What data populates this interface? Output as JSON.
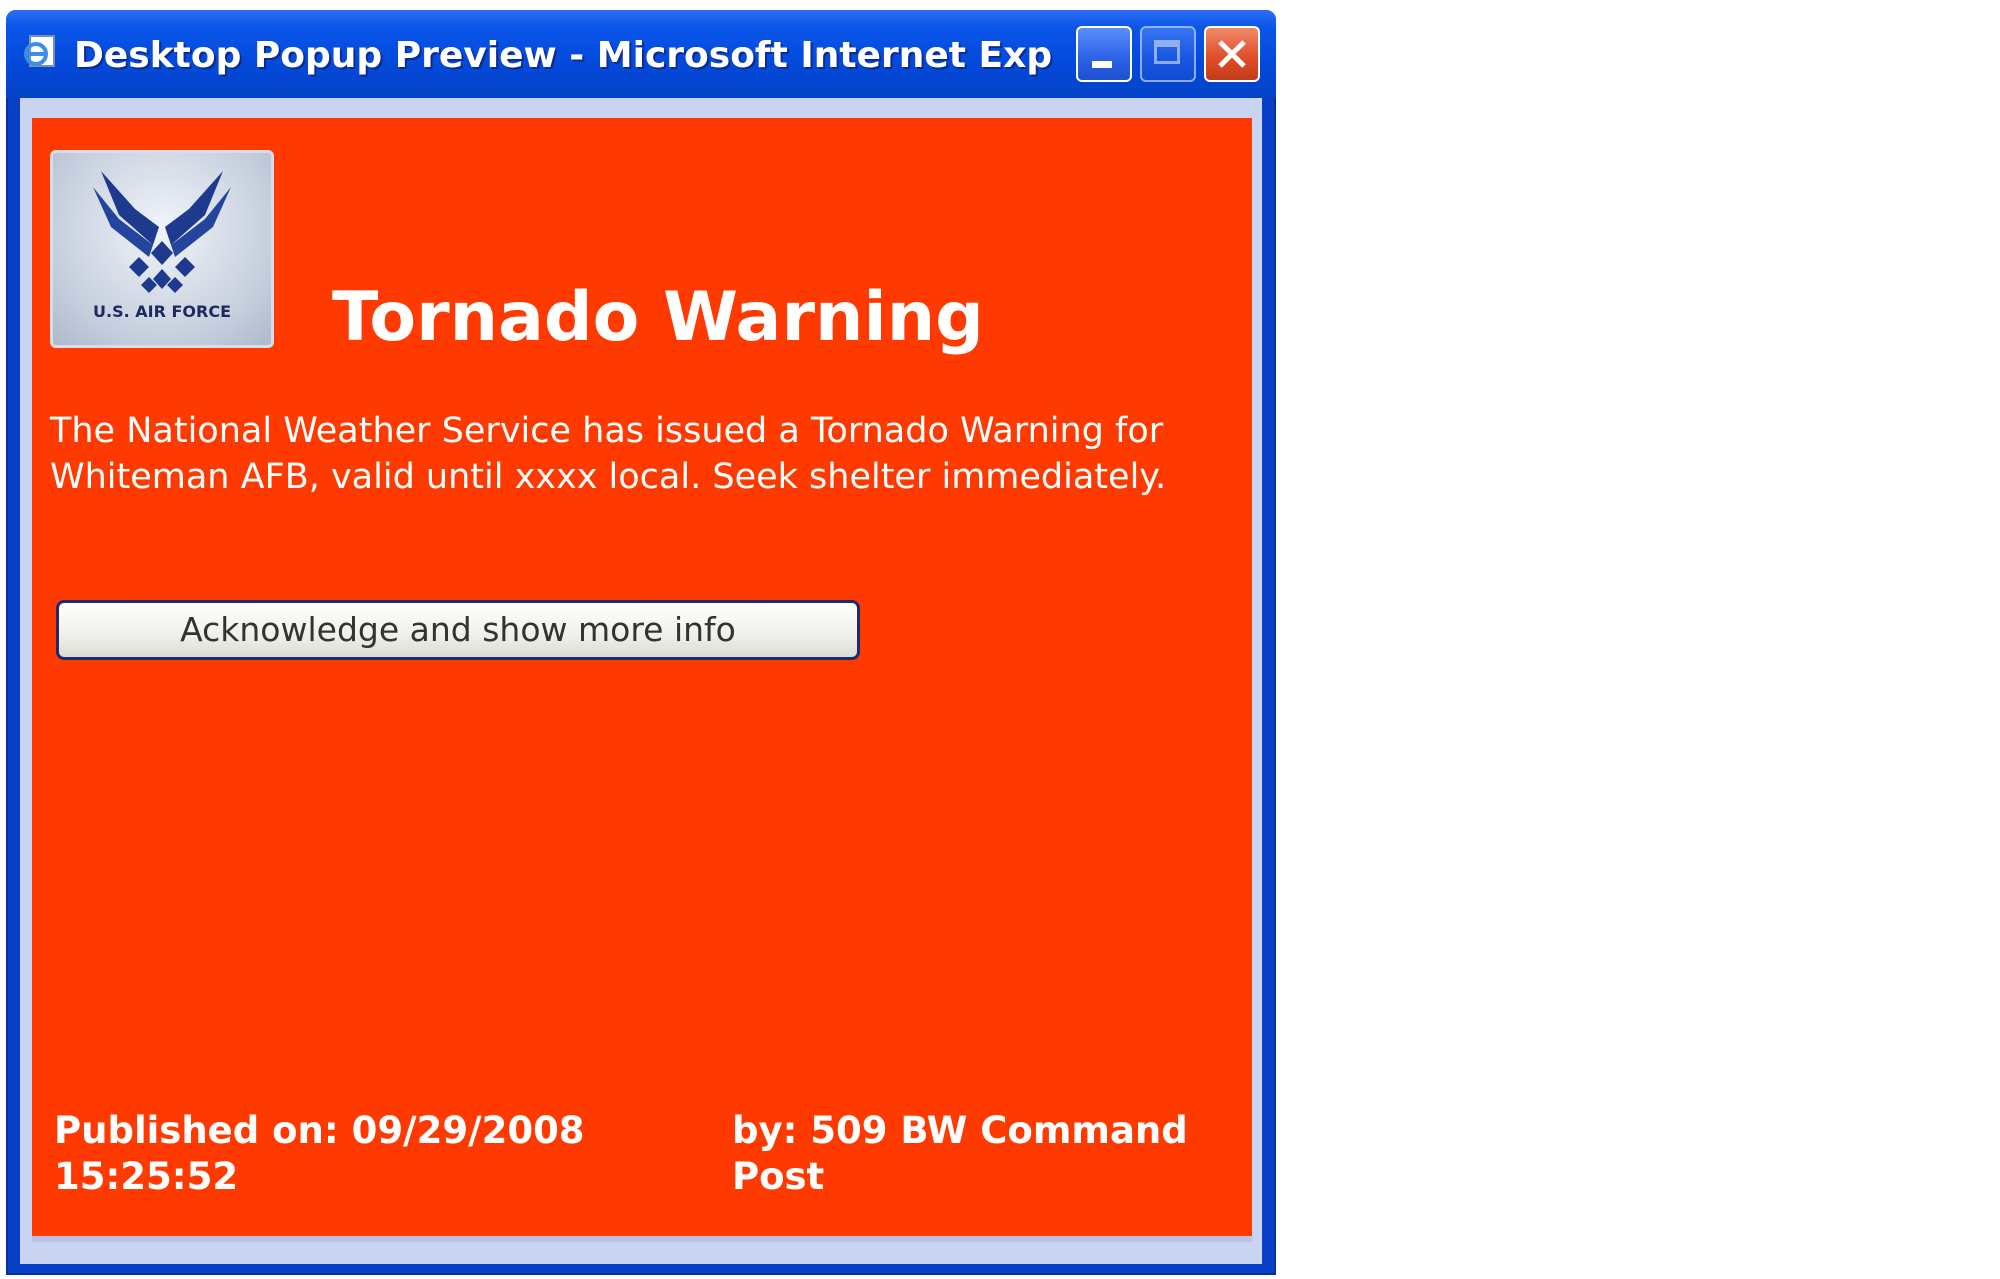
{
  "window": {
    "title": "Desktop Popup Preview - Microsoft Internet Explorer ...",
    "title_icon": "ie-page-icon",
    "controls": [
      "minimize-icon",
      "maximize-icon",
      "close-icon"
    ]
  },
  "alert": {
    "logo": "us-air-force-logo",
    "logo_text": "U.S. AIR FORCE",
    "headline": "Tornado Warning",
    "message": "The National Weather Service has issued a Tornado Warning for Whiteman AFB, valid until xxxx local. Seek shelter immediately.",
    "ack_button_label": "Acknowledge and show more info",
    "published": "Published on: 09/29/2008 15:25:52",
    "author": "by: 509 BW Command Post"
  },
  "colors": {
    "alert_background": "#ff3a00",
    "titlebar": "#0a56e8",
    "text": "#ffffff"
  }
}
